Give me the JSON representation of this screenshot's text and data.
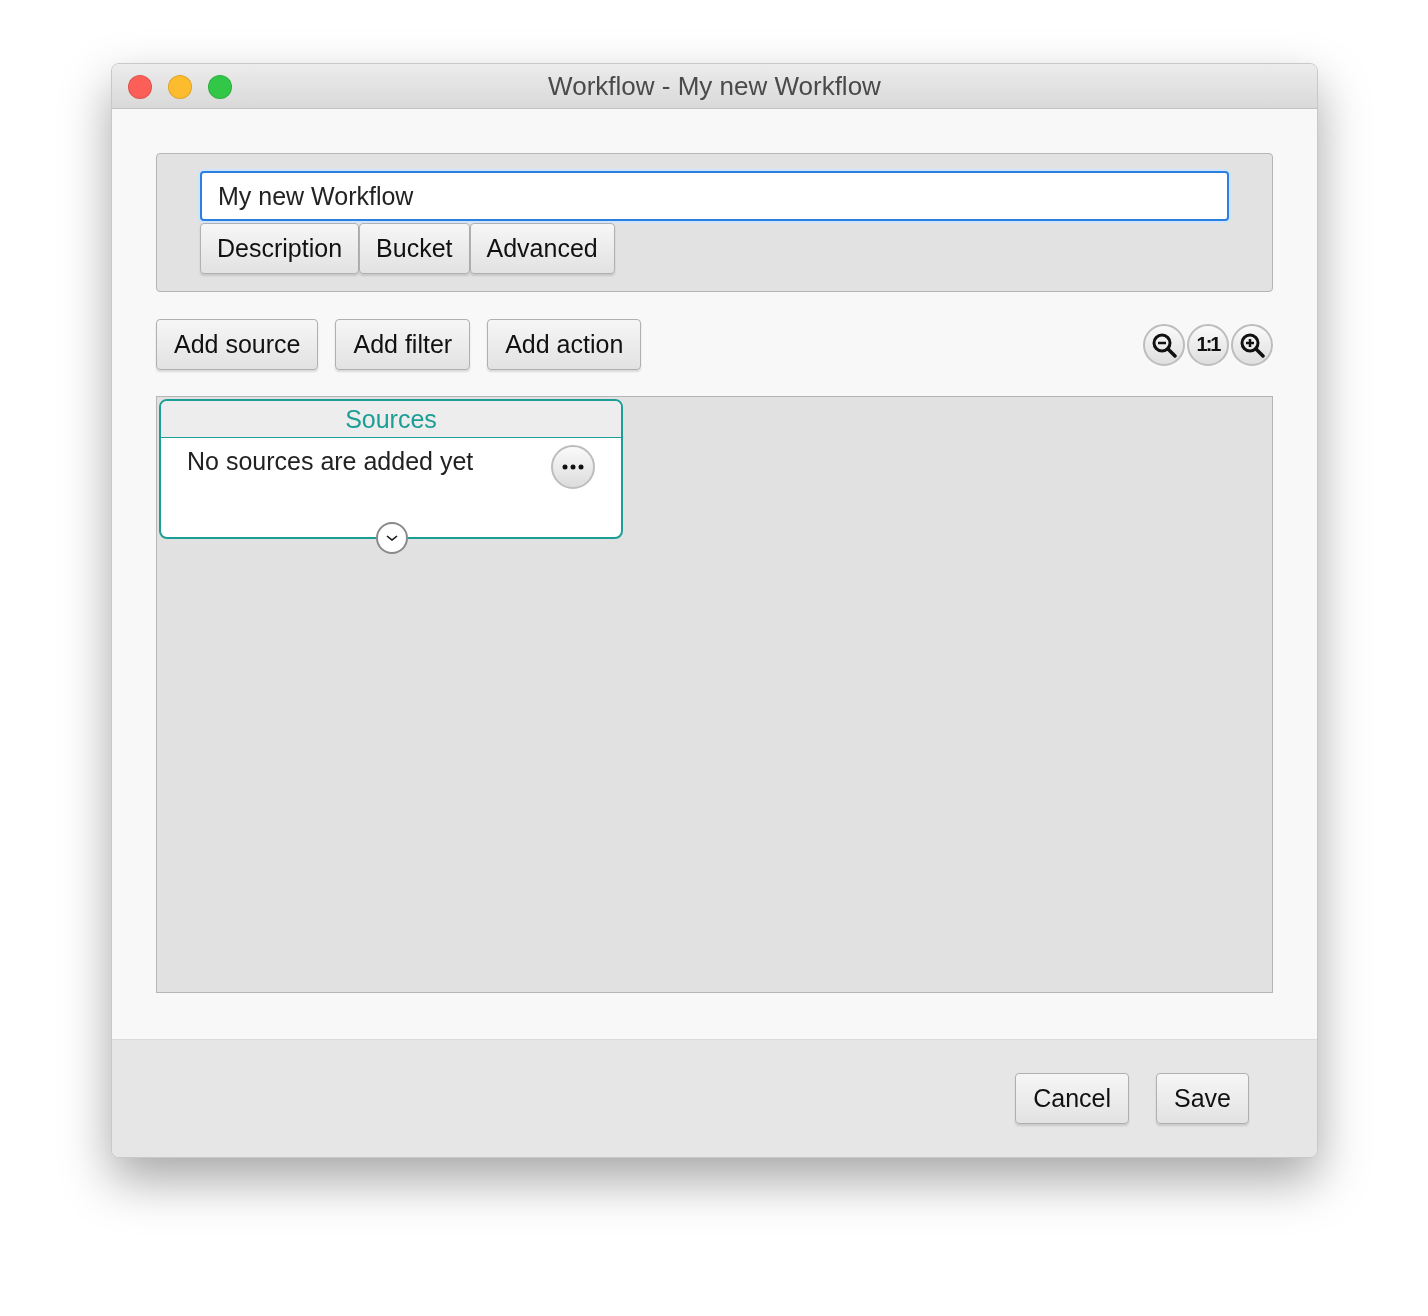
{
  "window": {
    "title": "Workflow - My new Workflow"
  },
  "name_field": {
    "value": "My new Workflow",
    "focused": true
  },
  "section_buttons": [
    "Description",
    "Bucket",
    "Advanced"
  ],
  "toolbar": {
    "buttons": [
      "Add source",
      "Add filter",
      "Add action"
    ],
    "zoom_reset": "1:1"
  },
  "canvas": {
    "nodes": [
      {
        "title": "Sources",
        "message": "No sources are added yet",
        "color": "#1a9e96"
      }
    ]
  },
  "footer": {
    "buttons": [
      "Cancel",
      "Save"
    ]
  }
}
